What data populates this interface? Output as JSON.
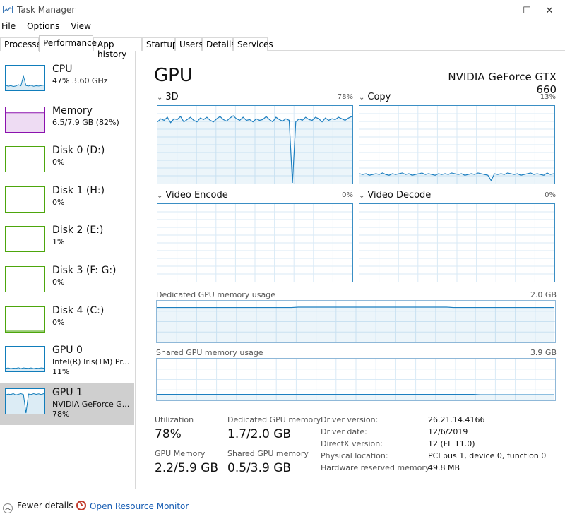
{
  "window": {
    "title": "Task Manager",
    "controls": {
      "minimize": "—",
      "maximize": "☐",
      "close": "✕"
    }
  },
  "menu": [
    "File",
    "Options",
    "View"
  ],
  "tabs": [
    "Processes",
    "Performance",
    "App history",
    "Startup",
    "Users",
    "Details",
    "Services"
  ],
  "active_tab": "Performance",
  "sidebar": {
    "items": [
      {
        "name": "CPU",
        "sub1": "47% 3.60 GHz",
        "sub2": "",
        "color": "#117dbb"
      },
      {
        "name": "Memory",
        "sub1": "6.5/7.9 GB (82%)",
        "sub2": "",
        "color": "#8b12ae"
      },
      {
        "name": "Disk 0 (D:)",
        "sub1": "0%",
        "sub2": "",
        "color": "#4da60c"
      },
      {
        "name": "Disk 1 (H:)",
        "sub1": "0%",
        "sub2": "",
        "color": "#4da60c"
      },
      {
        "name": "Disk 2 (E:)",
        "sub1": "1%",
        "sub2": "",
        "color": "#4da60c"
      },
      {
        "name": "Disk 3 (F: G:)",
        "sub1": "0%",
        "sub2": "",
        "color": "#4da60c"
      },
      {
        "name": "Disk 4 (C:)",
        "sub1": "0%",
        "sub2": "",
        "color": "#4da60c"
      },
      {
        "name": "GPU 0",
        "sub1": "Intel(R) Iris(TM) Pr...",
        "sub2": "11%",
        "color": "#117dbb"
      },
      {
        "name": "GPU 1",
        "sub1": "NVIDIA GeForce G...",
        "sub2": "78%",
        "color": "#117dbb"
      }
    ],
    "selected_index": 8
  },
  "main": {
    "title": "GPU",
    "model": "NVIDIA GeForce GTX 660",
    "engines": [
      {
        "label": "3D",
        "pct": "78%"
      },
      {
        "label": "Copy",
        "pct": "13%"
      },
      {
        "label": "Video Encode",
        "pct": "0%"
      },
      {
        "label": "Video Decode",
        "pct": "0%"
      }
    ],
    "dedicated_mem": {
      "label": "Dedicated GPU memory usage",
      "cap": "2.0 GB"
    },
    "shared_mem": {
      "label": "Shared GPU memory usage",
      "cap": "3.9 GB"
    },
    "stats": {
      "utilization": {
        "label": "Utilization",
        "value": "78%"
      },
      "dedicated": {
        "label": "Dedicated GPU memory",
        "value": "1.7/2.0 GB"
      },
      "gpu_memory": {
        "label": "GPU Memory",
        "value": "2.2/5.9 GB"
      },
      "shared": {
        "label": "Shared GPU memory",
        "value": "0.5/3.9 GB"
      }
    },
    "info": [
      {
        "key": "Driver version:",
        "value": "26.21.14.4166"
      },
      {
        "key": "Driver date:",
        "value": "12/6/2019"
      },
      {
        "key": "DirectX version:",
        "value": "12 (FL 11.0)"
      },
      {
        "key": "Physical location:",
        "value": "PCI bus 1, device 0, function 0"
      },
      {
        "key": "Hardware reserved memory:",
        "value": "49.8 MB"
      }
    ]
  },
  "series": {
    "gpu_3d": [
      80,
      84,
      82,
      86,
      79,
      84,
      83,
      87,
      80,
      83,
      86,
      82,
      80,
      85,
      83,
      86,
      82,
      80,
      84,
      87,
      83,
      81,
      85,
      88,
      84,
      82,
      86,
      82,
      83,
      80,
      84,
      82,
      83,
      87,
      83,
      80,
      86,
      83,
      81,
      84,
      82,
      0,
      80,
      84,
      82,
      86,
      83,
      82,
      86,
      84,
      80,
      85,
      82,
      84,
      83,
      86,
      84,
      82,
      85,
      87
    ],
    "copy": [
      12,
      11,
      12,
      10,
      11,
      12,
      11,
      13,
      11,
      10,
      12,
      11,
      12,
      13,
      11,
      12,
      10,
      11,
      12,
      13,
      11,
      12,
      11,
      10,
      12,
      11,
      12,
      11,
      13,
      12,
      11,
      12,
      10,
      11,
      12,
      11,
      13,
      12,
      11,
      10,
      3,
      12,
      11,
      12,
      11,
      13,
      12,
      11,
      12,
      10,
      11,
      12,
      13,
      11,
      12,
      11,
      10,
      13,
      11,
      12
    ],
    "dedicated_mem": [
      85,
      85,
      85,
      85,
      85,
      85,
      85,
      85,
      85,
      85,
      85,
      85,
      85,
      85,
      85,
      85,
      85,
      85,
      85,
      85,
      85,
      86,
      86,
      86,
      86,
      86,
      86,
      86,
      86,
      86,
      86,
      86,
      86,
      86,
      86,
      86,
      86,
      86,
      86,
      86,
      86,
      86,
      86,
      86,
      85,
      85,
      85,
      85,
      85,
      85,
      85,
      85,
      85,
      85,
      85,
      85,
      85,
      85,
      85,
      85
    ],
    "shared_mem": [
      13,
      13,
      13,
      13,
      13,
      13,
      13,
      13,
      13,
      13,
      13,
      13,
      13,
      13,
      13,
      13,
      13,
      13,
      13,
      13,
      13,
      13,
      13,
      13,
      13,
      13,
      13,
      13,
      13,
      13,
      13,
      13,
      13,
      13,
      13,
      13,
      13,
      13,
      13,
      13,
      13,
      13,
      13,
      13,
      13,
      13,
      13,
      13,
      12,
      12,
      12,
      12,
      12,
      12,
      12,
      12,
      12,
      12,
      12,
      12
    ],
    "cpu_thumb": [
      20,
      15,
      18,
      14,
      16,
      22,
      17,
      60,
      18,
      16,
      19,
      15,
      17,
      16,
      18,
      20
    ],
    "mem_thumb": [
      82,
      82,
      82,
      82,
      82,
      82,
      82,
      82,
      82,
      82,
      82,
      82,
      82,
      82,
      82,
      82
    ],
    "gpu0_thumb": [
      10,
      12,
      9,
      11,
      10,
      13,
      9,
      12,
      11,
      10,
      12,
      9,
      11,
      10,
      12,
      11
    ],
    "gpu1_thumb": [
      80,
      84,
      82,
      86,
      80,
      83,
      86,
      82,
      0,
      84,
      82,
      86,
      83,
      85,
      82,
      86
    ],
    "disk4_thumb": [
      0,
      0,
      0,
      0,
      0,
      0,
      0,
      0,
      0,
      0,
      0,
      0,
      0,
      0,
      0,
      0
    ]
  },
  "footer": {
    "fewer": "Fewer details",
    "resmon": "Open Resource Monitor"
  }
}
